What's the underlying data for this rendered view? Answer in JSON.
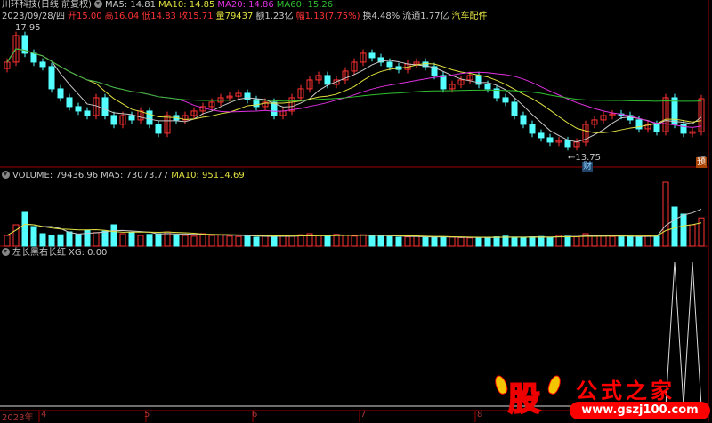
{
  "header": {
    "stock": "川环科技(日线 前复权)",
    "ma5": "MA5: 14.81",
    "ma10": "MA10: 14.85",
    "ma20": "MA20: 14.86",
    "ma60": "MA60: 15.26",
    "date": "2023/09/28/四",
    "open": "开15.00",
    "high": "高16.04",
    "low": "低14.83",
    "close": "收15.71",
    "vol": "量79437",
    "amount": "额1.23亿",
    "change": "幅1.13(7.75%)",
    "turnover": "换4.48%",
    "float": "流通1.77亿",
    "sector": "汽车配件"
  },
  "volume_header": {
    "vol": "VOLUME: 79436.96",
    "ma5": "MA5: 73073.77",
    "ma10": "MA10: 95114.69"
  },
  "indicator_header": {
    "name": "左长黑右长红",
    "xg": "XG: 0.00"
  },
  "annotations": {
    "high_label": "17.95",
    "low_label": "←13.75",
    "cai_badge": "财",
    "yu_badge": "预"
  },
  "xaxis": {
    "year": "2023年",
    "months": [
      "4",
      "5",
      "6",
      "7",
      "8"
    ]
  },
  "watermark": {
    "logo": "股",
    "title": "公式之家",
    "url": "www.gszj100.com"
  },
  "colors": {
    "up": "#ff3232",
    "down": "#54ffff",
    "ma5": "#c8c8c8",
    "ma10": "#e0e040",
    "ma20": "#e030e0",
    "ma60": "#30c030",
    "axis": "#a00000"
  },
  "chart_data": {
    "type": "candlestick",
    "price_range": [
      13.75,
      17.95
    ],
    "closes": [
      16.86,
      17.7,
      17.14,
      16.86,
      16.72,
      16.02,
      15.74,
      15.46,
      15.32,
      15.18,
      15.74,
      15.18,
      14.9,
      15.18,
      15.04,
      15.32,
      14.9,
      14.62,
      15.18,
      15.04,
      15.18,
      15.32,
      15.46,
      15.6,
      15.74,
      15.79,
      15.88,
      15.68,
      15.46,
      15.6,
      15.18,
      15.32,
      15.74,
      16.02,
      16.3,
      16.44,
      16.16,
      16.3,
      16.58,
      16.86,
      17.14,
      17.0,
      16.86,
      16.72,
      16.63,
      16.8,
      16.86,
      16.72,
      16.44,
      16.02,
      16.16,
      16.3,
      16.44,
      16.16,
      16.02,
      15.74,
      15.6,
      15.18,
      14.9,
      14.62,
      14.48,
      14.34,
      14.39,
      14.2,
      14.34,
      14.9,
      15.04,
      15.18,
      15.23,
      15.18,
      15.04,
      14.76,
      14.9,
      14.67,
      15.74,
      14.9,
      14.62,
      14.67,
      15.71
    ],
    "volumes": [
      30000,
      60000,
      95000,
      55000,
      35000,
      30000,
      32000,
      40000,
      33000,
      45000,
      38000,
      42000,
      60000,
      35000,
      38000,
      30000,
      33000,
      35000,
      40000,
      32000,
      30000,
      28000,
      35000,
      30000,
      32000,
      28000,
      27000,
      30000,
      25000,
      28000,
      26000,
      30000,
      28000,
      32000,
      35000,
      30000,
      28000,
      33000,
      30000,
      28000,
      32000,
      30000,
      28000,
      27000,
      25000,
      26000,
      28000,
      25000,
      24000,
      26000,
      25000,
      24000,
      23000,
      25000,
      24000,
      26000,
      28000,
      25000,
      24000,
      26000,
      27000,
      25000,
      30000,
      28000,
      26000,
      35000,
      30000,
      28000,
      27000,
      26000,
      28000,
      25000,
      30000,
      28000,
      180000,
      110000,
      90000,
      60000,
      79437
    ],
    "xg": [
      0,
      0,
      0,
      0,
      0,
      0,
      0,
      0,
      0,
      0,
      0,
      0,
      0,
      0,
      0,
      0,
      0,
      0,
      0,
      0,
      0,
      0,
      0,
      0,
      0,
      0,
      0,
      0,
      0,
      0,
      0,
      0,
      0,
      0,
      0,
      0,
      0,
      0,
      0,
      0,
      0,
      0,
      0,
      0,
      0,
      0,
      0,
      0,
      0,
      0,
      0,
      0,
      0,
      0,
      0,
      0,
      0,
      0,
      0,
      0,
      0,
      0,
      0,
      0,
      0,
      0,
      0,
      0,
      0,
      0,
      0,
      0,
      0,
      0,
      0,
      1,
      0,
      1,
      0
    ],
    "month_start_index": [
      4,
      16,
      28,
      40,
      53
    ]
  }
}
